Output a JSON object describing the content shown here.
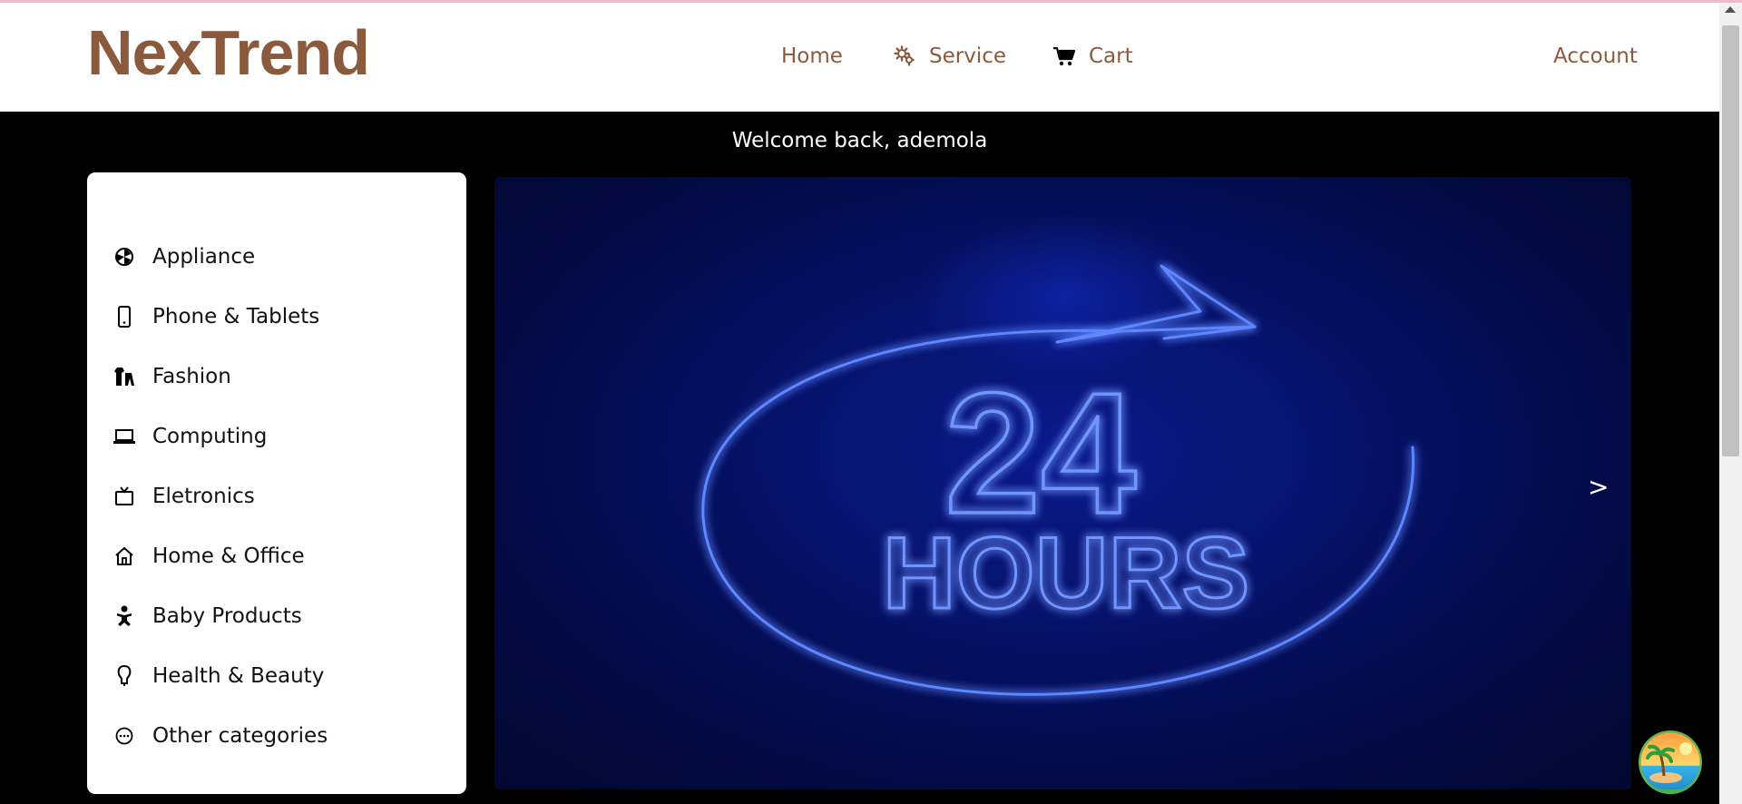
{
  "brand": {
    "name": "NexTrend",
    "color": "#8b5a3c"
  },
  "nav": {
    "home": "Home",
    "service": "Service",
    "cart": "Cart",
    "account": "Account"
  },
  "welcome": "Welcome back, ademola",
  "categories": [
    {
      "label": "Appliance",
      "icon": "appliance-icon"
    },
    {
      "label": "Phone & Tablets",
      "icon": "phone-icon"
    },
    {
      "label": "Fashion",
      "icon": "fashion-icon"
    },
    {
      "label": "Computing",
      "icon": "laptop-icon"
    },
    {
      "label": "Eletronics",
      "icon": "tv-icon"
    },
    {
      "label": "Home & Office",
      "icon": "house-icon"
    },
    {
      "label": "Baby Products",
      "icon": "baby-icon"
    },
    {
      "label": "Health & Beauty",
      "icon": "health-icon"
    },
    {
      "label": "Other categories",
      "icon": "more-icon"
    }
  ],
  "banner": {
    "line1": "24",
    "line2": "HOURS",
    "next": ">"
  },
  "colors": {
    "neon": "#3d6bff",
    "banner_bg": "#06126a"
  }
}
